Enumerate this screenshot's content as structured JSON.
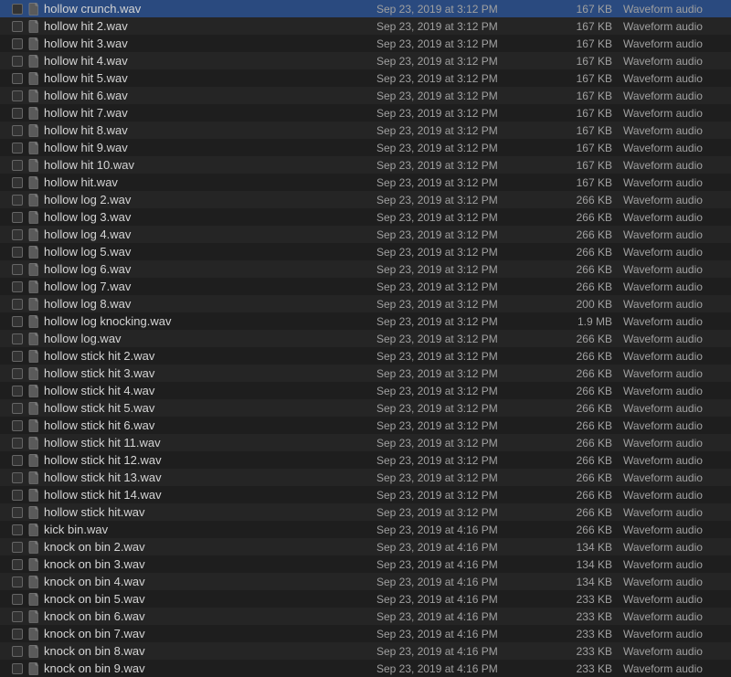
{
  "files": [
    {
      "name": "hollow crunch.wav",
      "date": "Sep 23, 2019 at 3:12 PM",
      "size": "167 KB",
      "kind": "Waveform audio"
    },
    {
      "name": "hollow hit 2.wav",
      "date": "Sep 23, 2019 at 3:12 PM",
      "size": "167 KB",
      "kind": "Waveform audio"
    },
    {
      "name": "hollow hit 3.wav",
      "date": "Sep 23, 2019 at 3:12 PM",
      "size": "167 KB",
      "kind": "Waveform audio"
    },
    {
      "name": "hollow hit 4.wav",
      "date": "Sep 23, 2019 at 3:12 PM",
      "size": "167 KB",
      "kind": "Waveform audio"
    },
    {
      "name": "hollow hit 5.wav",
      "date": "Sep 23, 2019 at 3:12 PM",
      "size": "167 KB",
      "kind": "Waveform audio"
    },
    {
      "name": "hollow hit 6.wav",
      "date": "Sep 23, 2019 at 3:12 PM",
      "size": "167 KB",
      "kind": "Waveform audio"
    },
    {
      "name": "hollow hit 7.wav",
      "date": "Sep 23, 2019 at 3:12 PM",
      "size": "167 KB",
      "kind": "Waveform audio"
    },
    {
      "name": "hollow hit 8.wav",
      "date": "Sep 23, 2019 at 3:12 PM",
      "size": "167 KB",
      "kind": "Waveform audio"
    },
    {
      "name": "hollow hit 9.wav",
      "date": "Sep 23, 2019 at 3:12 PM",
      "size": "167 KB",
      "kind": "Waveform audio"
    },
    {
      "name": "hollow hit 10.wav",
      "date": "Sep 23, 2019 at 3:12 PM",
      "size": "167 KB",
      "kind": "Waveform audio"
    },
    {
      "name": "hollow hit.wav",
      "date": "Sep 23, 2019 at 3:12 PM",
      "size": "167 KB",
      "kind": "Waveform audio"
    },
    {
      "name": "hollow log 2.wav",
      "date": "Sep 23, 2019 at 3:12 PM",
      "size": "266 KB",
      "kind": "Waveform audio"
    },
    {
      "name": "hollow log 3.wav",
      "date": "Sep 23, 2019 at 3:12 PM",
      "size": "266 KB",
      "kind": "Waveform audio"
    },
    {
      "name": "hollow log 4.wav",
      "date": "Sep 23, 2019 at 3:12 PM",
      "size": "266 KB",
      "kind": "Waveform audio"
    },
    {
      "name": "hollow log 5.wav",
      "date": "Sep 23, 2019 at 3:12 PM",
      "size": "266 KB",
      "kind": "Waveform audio"
    },
    {
      "name": "hollow log 6.wav",
      "date": "Sep 23, 2019 at 3:12 PM",
      "size": "266 KB",
      "kind": "Waveform audio"
    },
    {
      "name": "hollow log 7.wav",
      "date": "Sep 23, 2019 at 3:12 PM",
      "size": "266 KB",
      "kind": "Waveform audio"
    },
    {
      "name": "hollow log 8.wav",
      "date": "Sep 23, 2019 at 3:12 PM",
      "size": "200 KB",
      "kind": "Waveform audio"
    },
    {
      "name": "hollow log knocking.wav",
      "date": "Sep 23, 2019 at 3:12 PM",
      "size": "1.9 MB",
      "kind": "Waveform audio"
    },
    {
      "name": "hollow log.wav",
      "date": "Sep 23, 2019 at 3:12 PM",
      "size": "266 KB",
      "kind": "Waveform audio"
    },
    {
      "name": "hollow stick hit 2.wav",
      "date": "Sep 23, 2019 at 3:12 PM",
      "size": "266 KB",
      "kind": "Waveform audio"
    },
    {
      "name": "hollow stick hit 3.wav",
      "date": "Sep 23, 2019 at 3:12 PM",
      "size": "266 KB",
      "kind": "Waveform audio"
    },
    {
      "name": "hollow stick hit 4.wav",
      "date": "Sep 23, 2019 at 3:12 PM",
      "size": "266 KB",
      "kind": "Waveform audio"
    },
    {
      "name": "hollow stick hit 5.wav",
      "date": "Sep 23, 2019 at 3:12 PM",
      "size": "266 KB",
      "kind": "Waveform audio"
    },
    {
      "name": "hollow stick hit 6.wav",
      "date": "Sep 23, 2019 at 3:12 PM",
      "size": "266 KB",
      "kind": "Waveform audio"
    },
    {
      "name": "hollow stick hit 11.wav",
      "date": "Sep 23, 2019 at 3:12 PM",
      "size": "266 KB",
      "kind": "Waveform audio"
    },
    {
      "name": "hollow stick hit 12.wav",
      "date": "Sep 23, 2019 at 3:12 PM",
      "size": "266 KB",
      "kind": "Waveform audio"
    },
    {
      "name": "hollow stick hit 13.wav",
      "date": "Sep 23, 2019 at 3:12 PM",
      "size": "266 KB",
      "kind": "Waveform audio"
    },
    {
      "name": "hollow stick hit 14.wav",
      "date": "Sep 23, 2019 at 3:12 PM",
      "size": "266 KB",
      "kind": "Waveform audio"
    },
    {
      "name": "hollow stick hit.wav",
      "date": "Sep 23, 2019 at 3:12 PM",
      "size": "266 KB",
      "kind": "Waveform audio"
    },
    {
      "name": "kick bin.wav",
      "date": "Sep 23, 2019 at 4:16 PM",
      "size": "266 KB",
      "kind": "Waveform audio"
    },
    {
      "name": "knock on bin 2.wav",
      "date": "Sep 23, 2019 at 4:16 PM",
      "size": "134 KB",
      "kind": "Waveform audio"
    },
    {
      "name": "knock on bin 3.wav",
      "date": "Sep 23, 2019 at 4:16 PM",
      "size": "134 KB",
      "kind": "Waveform audio"
    },
    {
      "name": "knock on bin 4.wav",
      "date": "Sep 23, 2019 at 4:16 PM",
      "size": "134 KB",
      "kind": "Waveform audio"
    },
    {
      "name": "knock on bin 5.wav",
      "date": "Sep 23, 2019 at 4:16 PM",
      "size": "233 KB",
      "kind": "Waveform audio"
    },
    {
      "name": "knock on bin 6.wav",
      "date": "Sep 23, 2019 at 4:16 PM",
      "size": "233 KB",
      "kind": "Waveform audio"
    },
    {
      "name": "knock on bin 7.wav",
      "date": "Sep 23, 2019 at 4:16 PM",
      "size": "233 KB",
      "kind": "Waveform audio"
    },
    {
      "name": "knock on bin 8.wav",
      "date": "Sep 23, 2019 at 4:16 PM",
      "size": "233 KB",
      "kind": "Waveform audio"
    },
    {
      "name": "knock on bin 9.wav",
      "date": "Sep 23, 2019 at 4:16 PM",
      "size": "233 KB",
      "kind": "Waveform audio"
    }
  ]
}
